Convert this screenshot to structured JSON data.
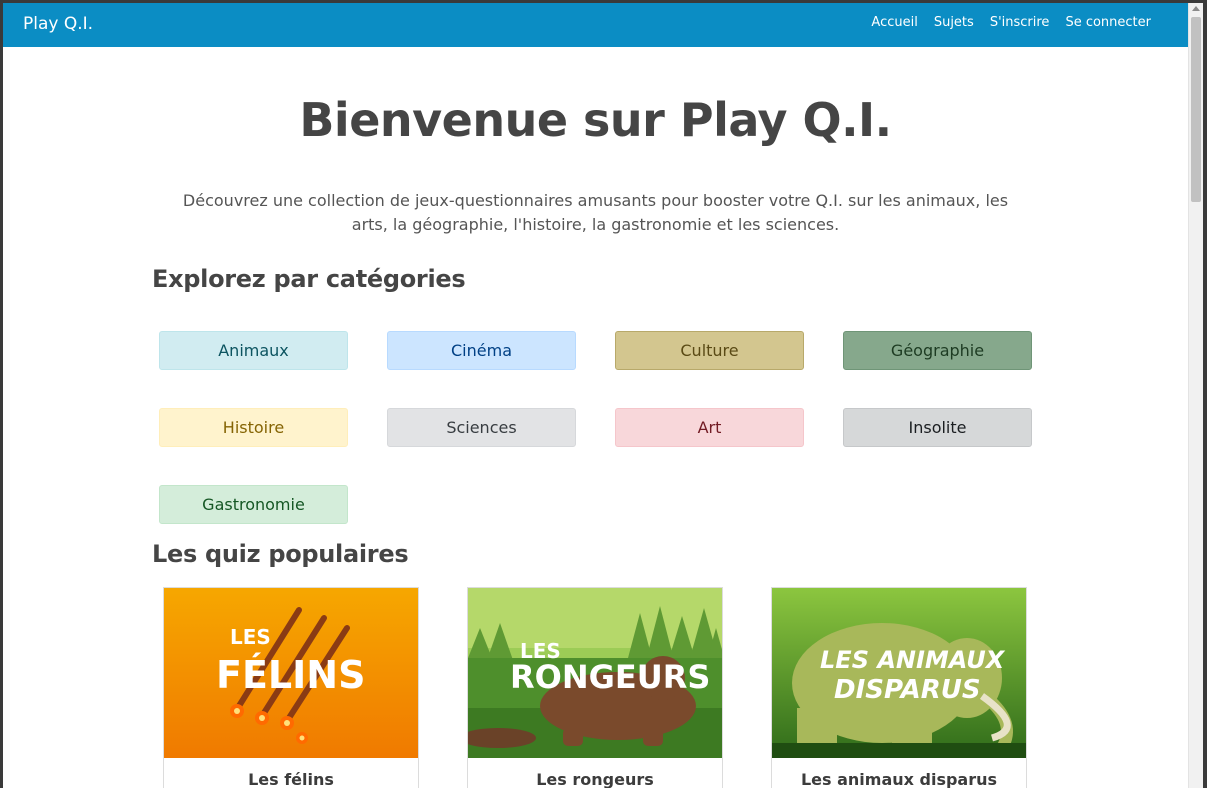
{
  "navbar": {
    "brand": "Play Q.I.",
    "links": [
      "Accueil",
      "Sujets",
      "S'inscrire",
      "Se connecter"
    ]
  },
  "hero": {
    "title": "Bienvenue sur Play Q.I.",
    "intro": "Découvrez une collection de jeux-questionnaires amusants pour booster votre Q.I. sur les animaux, les arts, la géographie, l'histoire, la gastronomie et les sciences."
  },
  "categories": {
    "heading": "Explorez par catégories",
    "items": [
      {
        "label": "Animaux",
        "bg": "#d1ecf1",
        "border": "#bee5eb",
        "color": "#0c5460"
      },
      {
        "label": "Cinéma",
        "bg": "#cce5ff",
        "border": "#b8daff",
        "color": "#004085"
      },
      {
        "label": "Culture",
        "bg": "#d3c68f",
        "border": "#b8a96a",
        "color": "#5a4a15"
      },
      {
        "label": "Géographie",
        "bg": "#86a88c",
        "border": "#6f9577",
        "color": "#1d3b22"
      },
      {
        "label": "Histoire",
        "bg": "#fff3cd",
        "border": "#ffeeba",
        "color": "#856404"
      },
      {
        "label": "Sciences",
        "bg": "#e2e3e5",
        "border": "#d6d8db",
        "color": "#383d41"
      },
      {
        "label": "Art",
        "bg": "#f8d7da",
        "border": "#f5c6cb",
        "color": "#721c24"
      },
      {
        "label": "Insolite",
        "bg": "#d6d8d9",
        "border": "#c6c8ca",
        "color": "#1b1e21"
      },
      {
        "label": "Gastronomie",
        "bg": "#d4edda",
        "border": "#c3e6cb",
        "color": "#155724"
      }
    ]
  },
  "popular": {
    "heading": "Les quiz populaires",
    "cards": [
      {
        "title": "Les félins",
        "art_line1": "LES",
        "art_line2": "FÉLINS"
      },
      {
        "title": "Les rongeurs",
        "art_line1": "LES",
        "art_line2": "RONGEURS"
      },
      {
        "title": "Les animaux disparus",
        "art_line1": "LES ANIMAUX",
        "art_line2": "DISPARUS"
      }
    ]
  }
}
